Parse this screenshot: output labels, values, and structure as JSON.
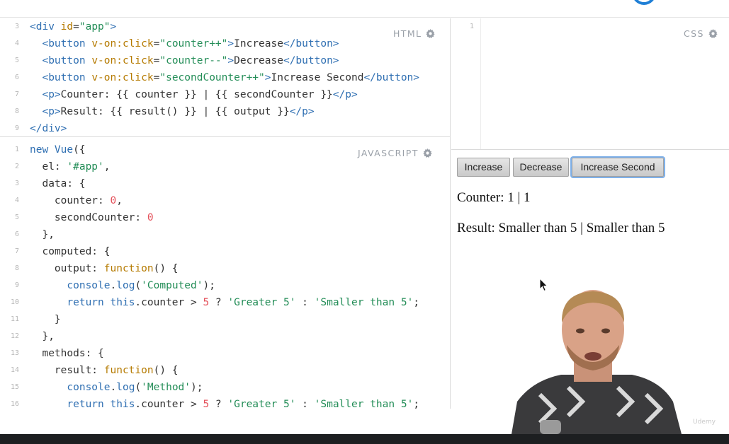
{
  "html_panel": {
    "label": "HTML",
    "line_numbers": [
      "3",
      "4",
      "5",
      "6",
      "7",
      "8",
      "9"
    ],
    "lines": [
      [
        [
          "tag",
          "<div "
        ],
        [
          "attr",
          "id"
        ],
        [
          "plain",
          "="
        ],
        [
          "str",
          "\"app\""
        ],
        [
          "tag",
          ">"
        ]
      ],
      [
        [
          "plain",
          "  "
        ],
        [
          "tag",
          "<button "
        ],
        [
          "attr",
          "v-on:click"
        ],
        [
          "plain",
          "="
        ],
        [
          "str",
          "\"counter++\""
        ],
        [
          "tag",
          ">"
        ],
        [
          "plain",
          "Increase"
        ],
        [
          "tag",
          "</button>"
        ]
      ],
      [
        [
          "plain",
          "  "
        ],
        [
          "tag",
          "<button "
        ],
        [
          "attr",
          "v-on:click"
        ],
        [
          "plain",
          "="
        ],
        [
          "str",
          "\"counter--\""
        ],
        [
          "tag",
          ">"
        ],
        [
          "plain",
          "Decrease"
        ],
        [
          "tag",
          "</button>"
        ]
      ],
      [
        [
          "plain",
          "  "
        ],
        [
          "tag",
          "<button "
        ],
        [
          "attr",
          "v-on:click"
        ],
        [
          "plain",
          "="
        ],
        [
          "str",
          "\"secondCounter++\""
        ],
        [
          "tag",
          ">"
        ],
        [
          "plain",
          "Increase Second"
        ],
        [
          "tag",
          "</button>"
        ]
      ],
      [
        [
          "plain",
          "  "
        ],
        [
          "tag",
          "<p>"
        ],
        [
          "plain",
          "Counter: {{ counter }} | {{ secondCounter }}"
        ],
        [
          "tag",
          "</p>"
        ]
      ],
      [
        [
          "plain",
          "  "
        ],
        [
          "tag",
          "<p>"
        ],
        [
          "plain",
          "Result: {{ result() }} | {{ output }}"
        ],
        [
          "tag",
          "</p>"
        ]
      ],
      [
        [
          "tag",
          "</div>"
        ]
      ]
    ]
  },
  "js_panel": {
    "label": "JAVASCRIPT",
    "line_numbers": [
      "1",
      "2",
      "3",
      "4",
      "5",
      "6",
      "7",
      "8",
      "9",
      "10",
      "11",
      "12",
      "13",
      "14",
      "15",
      "16"
    ],
    "lines": [
      [
        [
          "kw",
          "new "
        ],
        [
          "kw",
          "Vue"
        ],
        [
          "plain",
          "({"
        ]
      ],
      [
        [
          "plain",
          "  el: "
        ],
        [
          "str",
          "'#app'"
        ],
        [
          "plain",
          ","
        ]
      ],
      [
        [
          "plain",
          "  data: {"
        ]
      ],
      [
        [
          "plain",
          "    counter: "
        ],
        [
          "num",
          "0"
        ],
        [
          "plain",
          ","
        ]
      ],
      [
        [
          "plain",
          "    secondCounter: "
        ],
        [
          "num",
          "0"
        ]
      ],
      [
        [
          "plain",
          "  },"
        ]
      ],
      [
        [
          "plain",
          "  computed: {"
        ]
      ],
      [
        [
          "plain",
          "    output: "
        ],
        [
          "fn",
          "function"
        ],
        [
          "plain",
          "() {"
        ]
      ],
      [
        [
          "plain",
          "      "
        ],
        [
          "kw",
          "console"
        ],
        [
          "plain",
          "."
        ],
        [
          "kw",
          "log"
        ],
        [
          "plain",
          "("
        ],
        [
          "str",
          "'Computed'"
        ],
        [
          "plain",
          ");"
        ]
      ],
      [
        [
          "plain",
          "      "
        ],
        [
          "kw",
          "return "
        ],
        [
          "kw",
          "this"
        ],
        [
          "plain",
          ".counter > "
        ],
        [
          "num",
          "5"
        ],
        [
          "plain",
          " ? "
        ],
        [
          "str",
          "'Greater 5'"
        ],
        [
          "plain",
          " : "
        ],
        [
          "str",
          "'Smaller than 5'"
        ],
        [
          "plain",
          ";"
        ]
      ],
      [
        [
          "plain",
          "    }"
        ]
      ],
      [
        [
          "plain",
          "  },"
        ]
      ],
      [
        [
          "plain",
          "  methods: {"
        ]
      ],
      [
        [
          "plain",
          "    result: "
        ],
        [
          "fn",
          "function"
        ],
        [
          "plain",
          "() {"
        ]
      ],
      [
        [
          "plain",
          "      "
        ],
        [
          "kw",
          "console"
        ],
        [
          "plain",
          "."
        ],
        [
          "kw",
          "log"
        ],
        [
          "plain",
          "("
        ],
        [
          "str",
          "'Method'"
        ],
        [
          "plain",
          ");"
        ]
      ],
      [
        [
          "plain",
          "      "
        ],
        [
          "kw",
          "return "
        ],
        [
          "kw",
          "this"
        ],
        [
          "plain",
          ".counter > "
        ],
        [
          "num",
          "5"
        ],
        [
          "plain",
          " ? "
        ],
        [
          "str",
          "'Greater 5'"
        ],
        [
          "plain",
          " : "
        ],
        [
          "str",
          "'Smaller than 5'"
        ],
        [
          "plain",
          ";"
        ]
      ]
    ]
  },
  "css_panel": {
    "label": "CSS",
    "line_number": "1"
  },
  "result": {
    "buttons": {
      "increase": "Increase",
      "decrease": "Decrease",
      "increase_second": "Increase Second"
    },
    "counter_text": "Counter: 1 | 1",
    "result_text": "Result: Smaller than 5 | Smaller than 5"
  },
  "watermark": "Udemy",
  "colors": {
    "tag": "#2f6fb2",
    "attribute": "#b57a00",
    "string": "#238d57",
    "number": "#e4505a",
    "accent_ring": "#1f7fd6"
  }
}
